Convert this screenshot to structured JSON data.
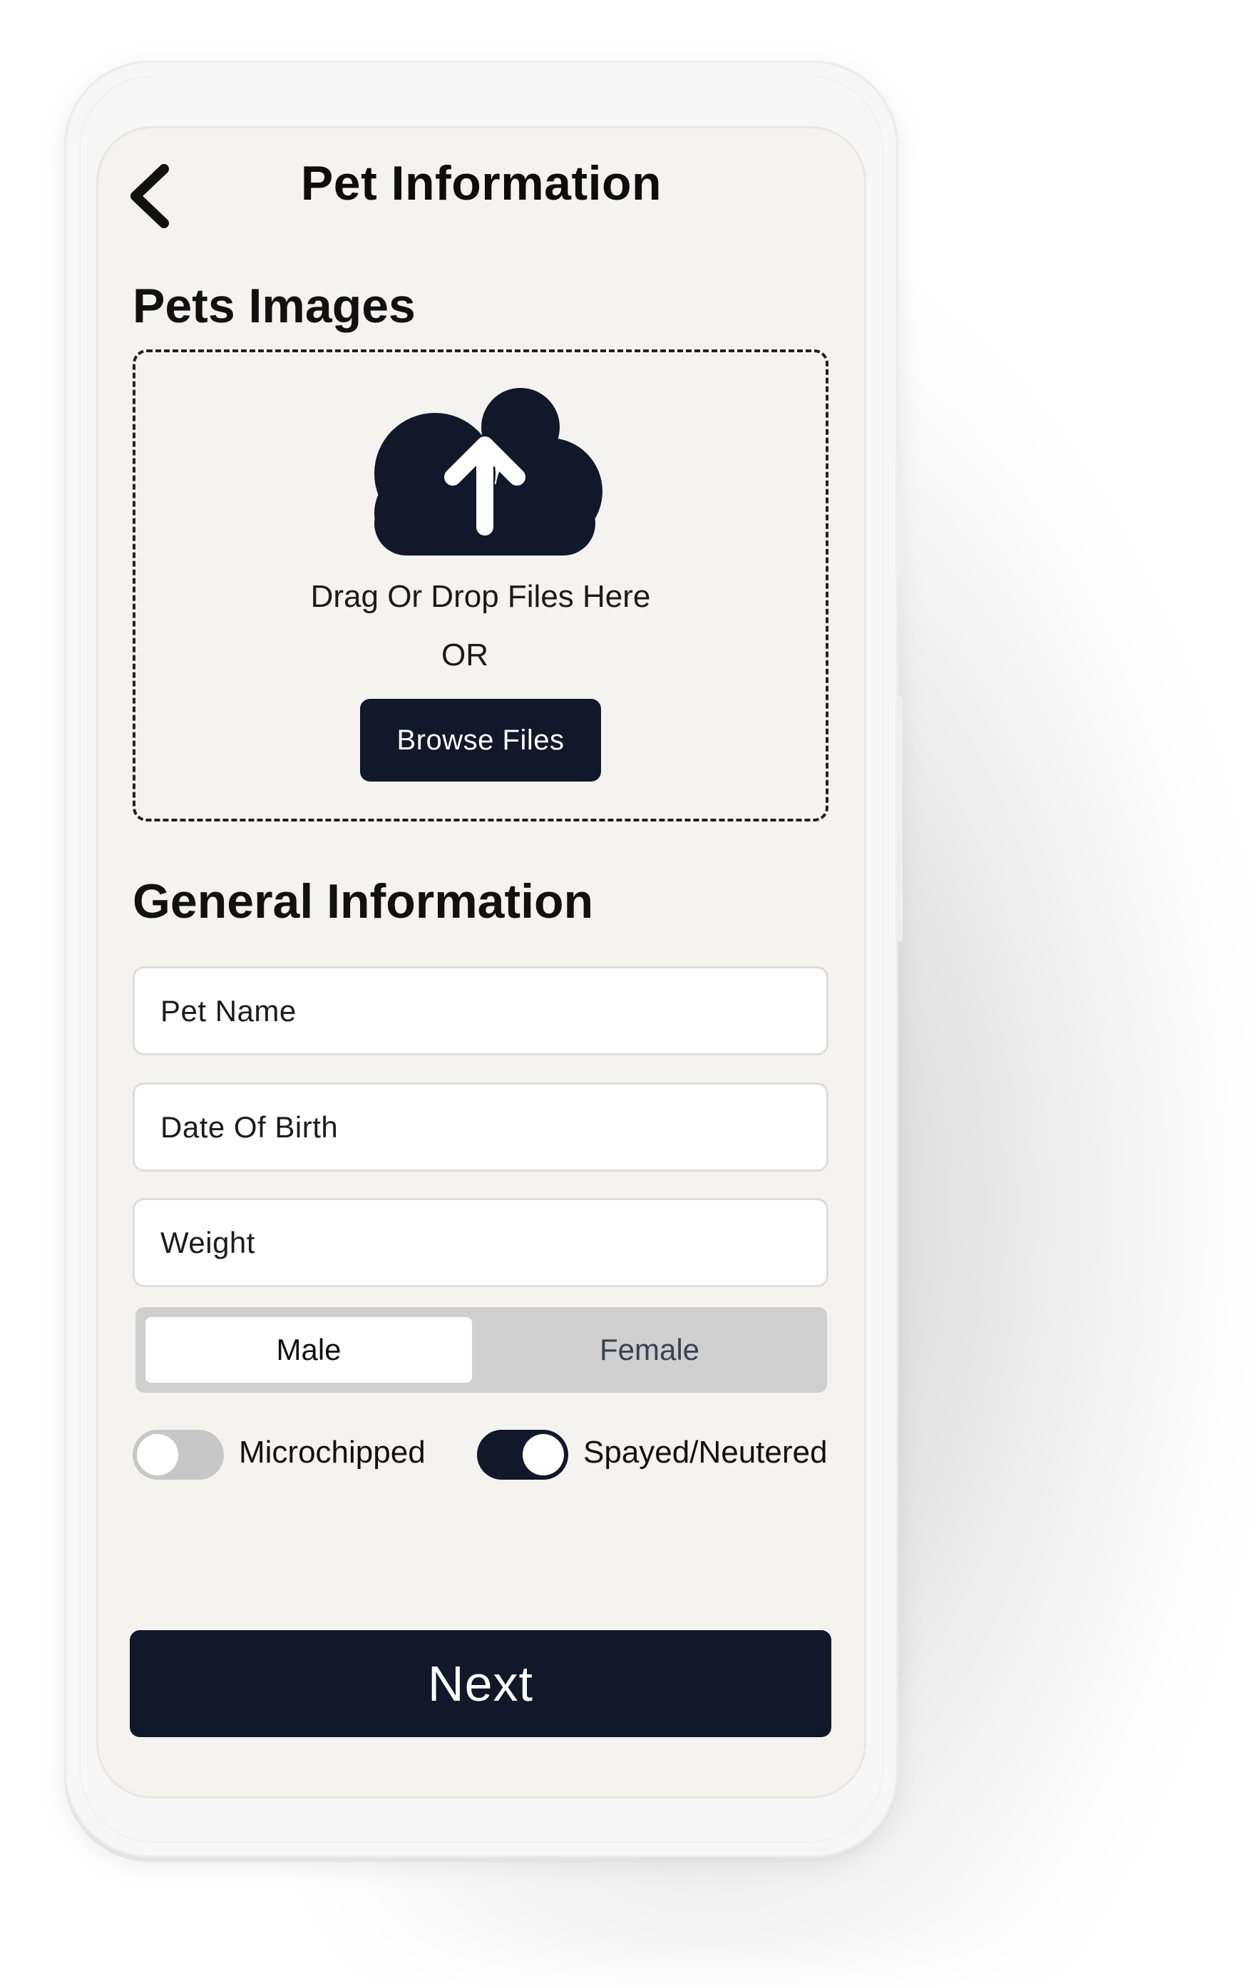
{
  "header": {
    "title": "Pet Information",
    "back_icon": "chevron-left-icon"
  },
  "images_section": {
    "title": "Pets Images",
    "upload_icon": "cloud-upload-icon",
    "drop_text": "Drag Or Drop Files Here",
    "or_text": "OR",
    "browse_label": "Browse Files"
  },
  "general_section": {
    "title": "General Information",
    "fields": {
      "pet_name": {
        "placeholder": "Pet Name",
        "value": ""
      },
      "date_of_birth": {
        "placeholder": "Date Of Birth",
        "value": ""
      },
      "weight": {
        "placeholder": "Weight",
        "value": ""
      }
    },
    "gender": {
      "options": [
        "Male",
        "Female"
      ],
      "selected": "Male"
    },
    "toggles": {
      "microchipped": {
        "label": "Microchipped",
        "on": false
      },
      "spayed_neutered": {
        "label": "Spayed/Neutered",
        "on": true
      }
    }
  },
  "footer": {
    "next_label": "Next"
  },
  "colors": {
    "primary_dark": "#111829",
    "screen_bg": "#f4f3ef",
    "toggle_off": "#c7c7c7",
    "segment_bg": "#cfcfcf"
  }
}
